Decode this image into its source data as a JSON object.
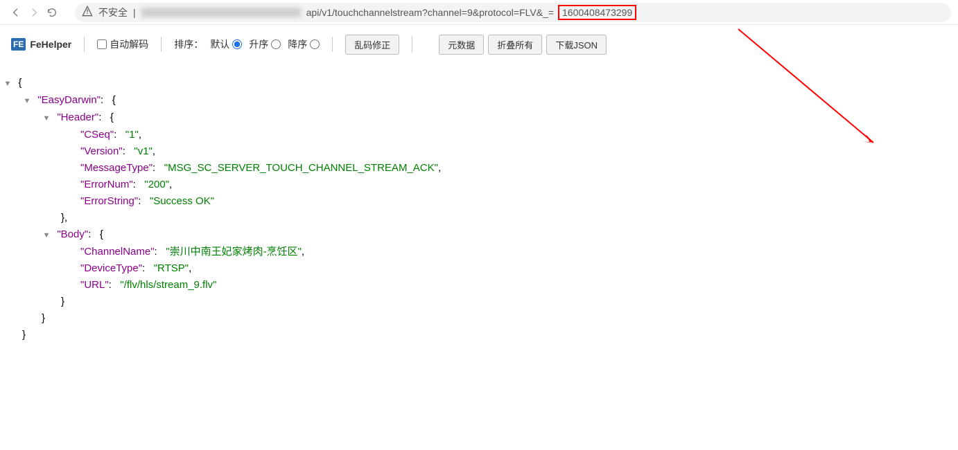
{
  "addressbar": {
    "insecure_label": "不安全",
    "url_prefix": "api/v1/touchchannelstream?channel=9&protocol=FLV&_=",
    "url_highlight": "1600408473299"
  },
  "toolbar": {
    "app_name": "FeHelper",
    "auto_decode_label": "自动解码",
    "sort_label": "排序：",
    "radio_default": "默认",
    "radio_asc": "升序",
    "radio_desc": "降序",
    "btn_fix": "乱码修正",
    "btn_meta": "元数据",
    "btn_collapse": "折叠所有",
    "btn_download": "下载JSON"
  },
  "json": {
    "root_key": "EasyDarwin",
    "header_key": "Header",
    "body_key": "Body",
    "cseq_k": "CSeq",
    "cseq_v": "1",
    "version_k": "Version",
    "version_v": "v1",
    "msgtype_k": "MessageType",
    "msgtype_v": "MSG_SC_SERVER_TOUCH_CHANNEL_STREAM_ACK",
    "errnum_k": "ErrorNum",
    "errnum_v": "200",
    "errstr_k": "ErrorString",
    "errstr_v": "Success OK",
    "chname_k": "ChannelName",
    "chname_v": "崇川中南王妃家烤肉-烹饪区",
    "devtype_k": "DeviceType",
    "devtype_v": "RTSP",
    "url_k": "URL",
    "url_v": "/flv/hls/stream_9.flv"
  }
}
